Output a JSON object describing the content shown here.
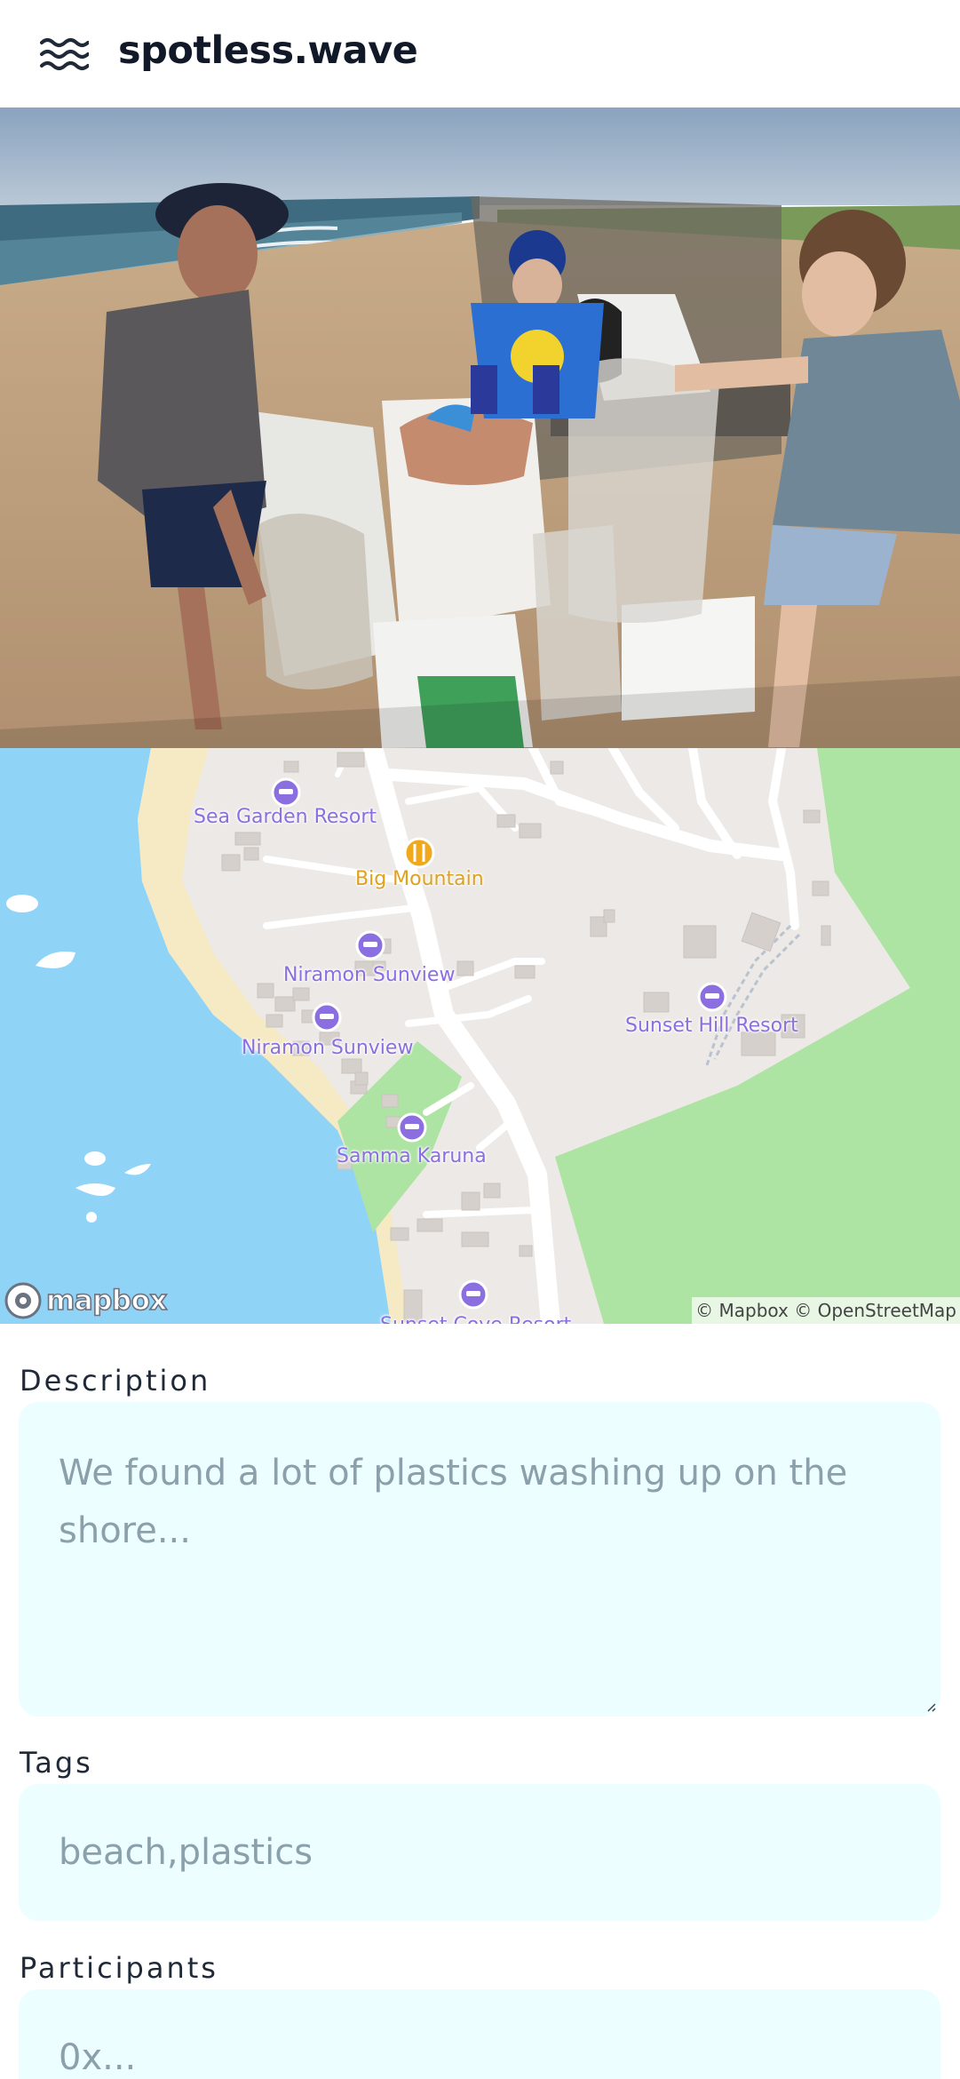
{
  "header": {
    "app_title": "spotless.wave",
    "menu_icon": "waves-icon"
  },
  "photo": {
    "alt": "Volunteers sorting collected beach waste into bags"
  },
  "map": {
    "places": [
      {
        "name": "Sea Garden Resort",
        "icon": "hotel-icon"
      },
      {
        "name": "Big Mountain",
        "icon": "restaurant-icon"
      },
      {
        "name": "Niramon Sunview",
        "icon": "hotel-icon"
      },
      {
        "name": "Niramon Sunview",
        "icon": "hotel-icon"
      },
      {
        "name": "Sunset Hill Resort",
        "icon": "hotel-icon"
      },
      {
        "name": "Samma Karuna",
        "icon": "hotel-icon"
      },
      {
        "name": "Sunset Cove Resort",
        "icon": "hotel-icon"
      }
    ],
    "logo": "mapbox",
    "attribution": "© Mapbox © OpenStreetMap",
    "colors": {
      "water": "#8fd4f7",
      "land": "#ede9e6",
      "park": "#ade3a3",
      "road": "#ffffff",
      "poi": "#8b6ee0",
      "food": "#e0a11b"
    }
  },
  "form": {
    "description": {
      "label": "Description",
      "placeholder": "We found a lot of plastics washing up on the shore..."
    },
    "tags": {
      "label": "Tags",
      "placeholder": "beach,plastics"
    },
    "participants": {
      "label": "Participants",
      "placeholder": "0x..."
    },
    "field_bg": "#ecfeff"
  }
}
